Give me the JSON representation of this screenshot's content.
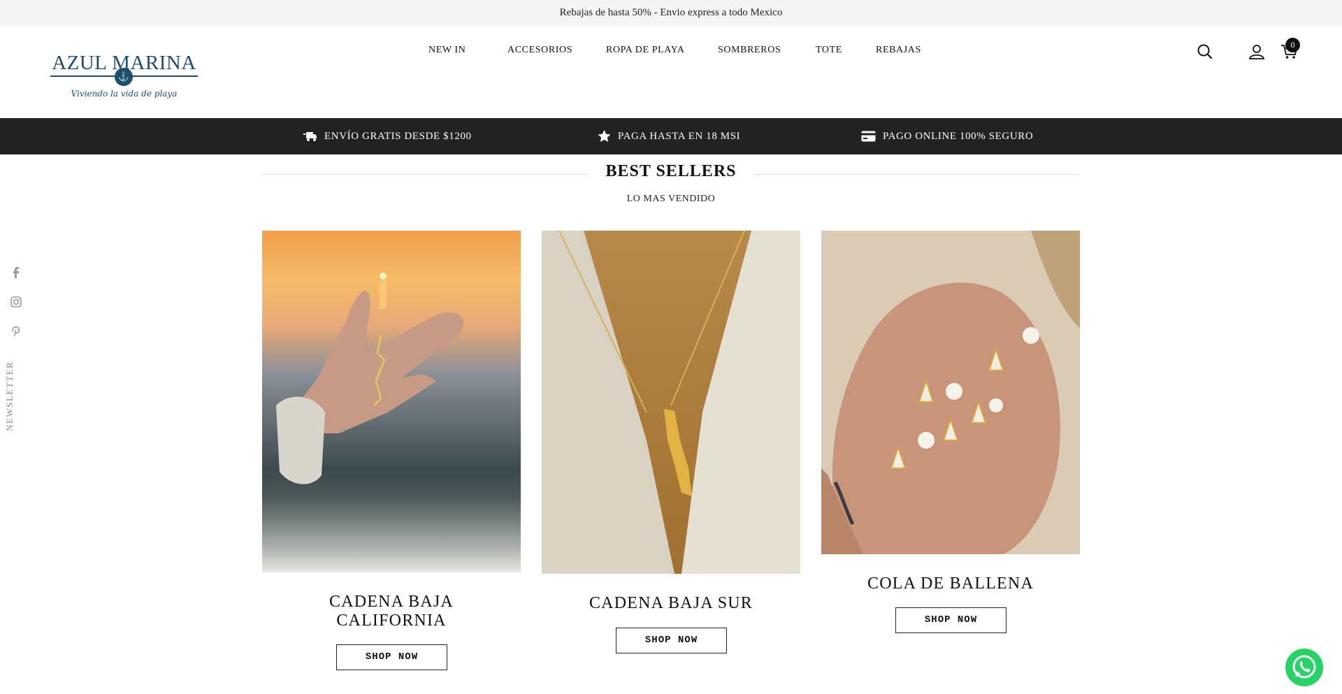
{
  "announcement": "Rebajas de hasta 50% - Envio express a todo Mexico",
  "logo": {
    "brand": "AZUL MARINA",
    "tagline": "Viviendo la vida de playa"
  },
  "nav": {
    "items": [
      {
        "label": "NEW IN"
      },
      {
        "label": "ACCESORIOS"
      },
      {
        "label": "ROPA DE PLAYA"
      },
      {
        "label": "SOMBREROS"
      },
      {
        "label": "TOTE"
      },
      {
        "label": "REBAJAS"
      }
    ]
  },
  "header_icons": {
    "search": "search-icon",
    "account": "user-icon",
    "cart": "cart-icon",
    "cart_count": "0"
  },
  "features": [
    {
      "icon": "truck-icon",
      "label": "ENVÍO GRATIS DESDE $1200"
    },
    {
      "icon": "star-icon",
      "label": "PAGA HASTA EN 18 MSI"
    },
    {
      "icon": "credit-card-icon",
      "label": "PAGO ONLINE 100% SEGURO"
    }
  ],
  "section": {
    "title": "BEST SELLERS",
    "subtitle": "LO MAS VENDIDO"
  },
  "products": [
    {
      "title_line1": "CADENA BAJA",
      "title_line2": "CALIFORNIA",
      "button": "SHOP NOW",
      "image": "hand holding gold Baja California necklace at sunset beach"
    },
    {
      "title": "CADENA BAJA SUR",
      "button": "SHOP NOW",
      "image": "gold Baja Sur pendant worn on neck"
    },
    {
      "title": "COLA DE BALLENA",
      "button": "SHOP NOW",
      "image": "whale tail pendants with pearls on palm"
    }
  ],
  "sidebar": {
    "socials": [
      "facebook-icon",
      "instagram-icon",
      "pinterest-icon"
    ],
    "newsletter": "NEWSLETTER"
  },
  "colors": {
    "brand_blue": "#1f4e6b",
    "feature_bar": "#222222",
    "announcement_bg": "#f5f5f5",
    "whatsapp": "#25d366"
  }
}
